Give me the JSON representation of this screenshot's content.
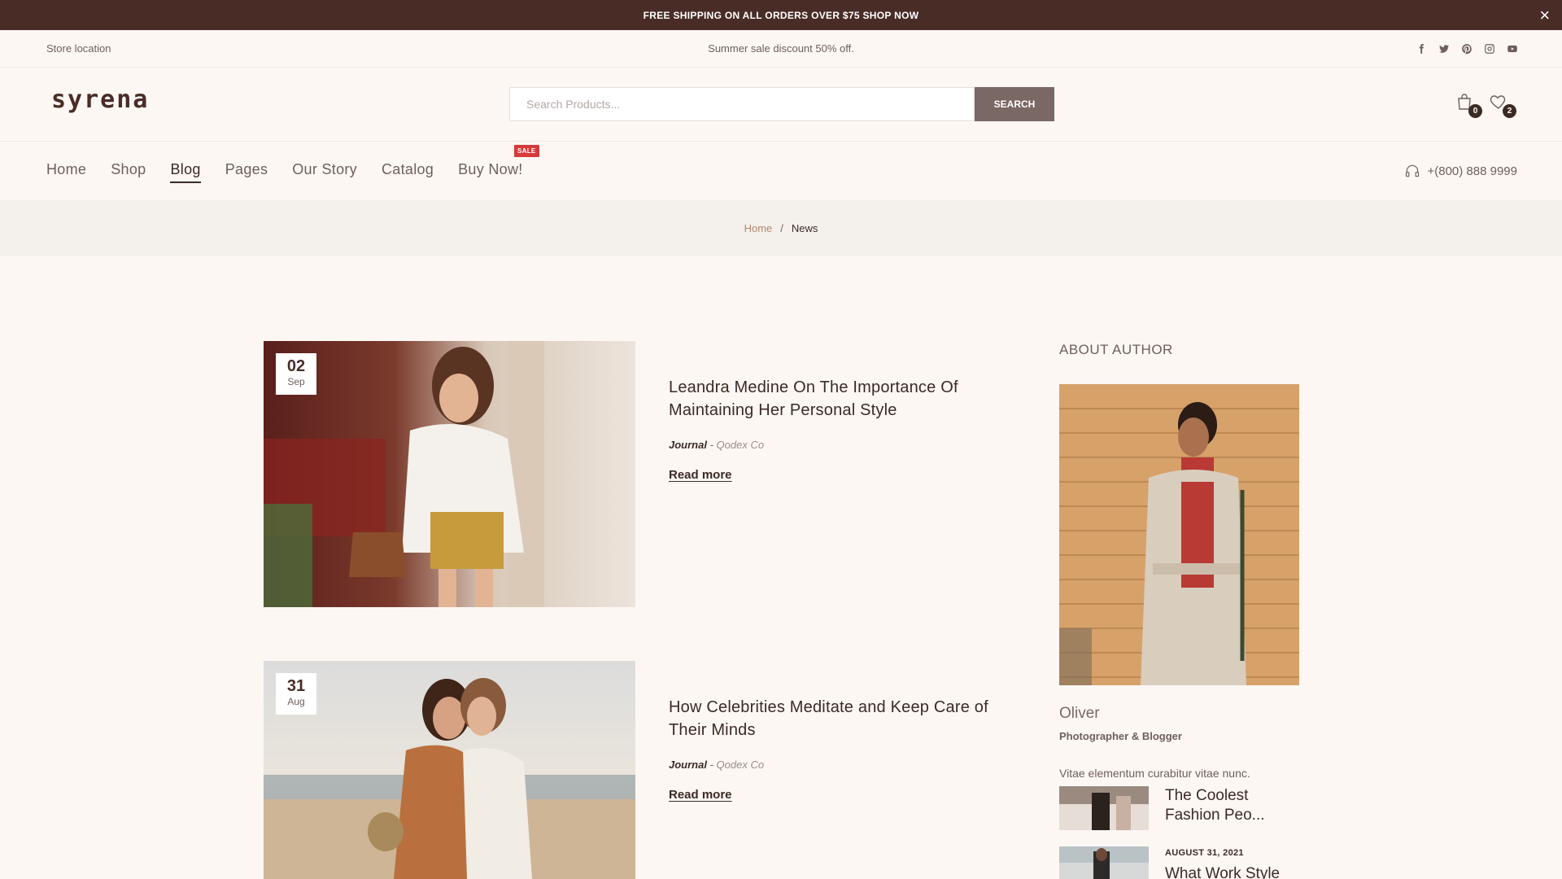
{
  "announcement": {
    "text": "FREE SHIPPING ON ALL ORDERS OVER $75 SHOP NOW",
    "close_icon": "×"
  },
  "infobar": {
    "store_location": "Store location",
    "sale_text": "Summer sale discount 50% off.",
    "social": [
      "facebook-icon",
      "twitter-icon",
      "pinterest-icon",
      "instagram-icon",
      "youtube-icon"
    ]
  },
  "header": {
    "logo": "syrena",
    "search_placeholder": "Search Products...",
    "search_button": "SEARCH",
    "cart_count": "0",
    "wishlist_count": "2"
  },
  "nav": {
    "items": [
      "Home",
      "Shop",
      "Blog",
      "Pages",
      "Our Story",
      "Catalog",
      "Buy Now!"
    ],
    "active": "Blog",
    "sale_tag": "SALE",
    "phone": "+(800) 888 9999"
  },
  "breadcrumb": {
    "home": "Home",
    "separator": "/",
    "current": "News"
  },
  "posts": [
    {
      "day": "02",
      "month": "Sep",
      "title": "Leandra Medine On The Importance Of Maintaining Her Personal Style",
      "category": "Journal",
      "author": "Qodex Co",
      "read_more": "Read more"
    },
    {
      "day": "31",
      "month": "Aug",
      "title": "How Celebrities Meditate and Keep Care of Their Minds",
      "category": "Journal",
      "author": "Qodex Co",
      "read_more": "Read more"
    }
  ],
  "sidebar": {
    "heading": "ABOUT AUTHOR",
    "author_name": "Oliver",
    "author_role": "Photographer & Blogger",
    "bio": "Vitae elementum curabitur vitae nunc.",
    "recent": [
      {
        "date": "",
        "title": "The Coolest Fashion Peo..."
      },
      {
        "date": "AUGUST 31, 2021",
        "title": "What Work Style"
      }
    ]
  },
  "colors": {
    "brand_dark": "#4a2c27",
    "background": "#fdf7f4",
    "search_button": "#7a6864",
    "sale_tag": "#d63a3a",
    "breadcrumb_bg": "#f4f1ec"
  }
}
